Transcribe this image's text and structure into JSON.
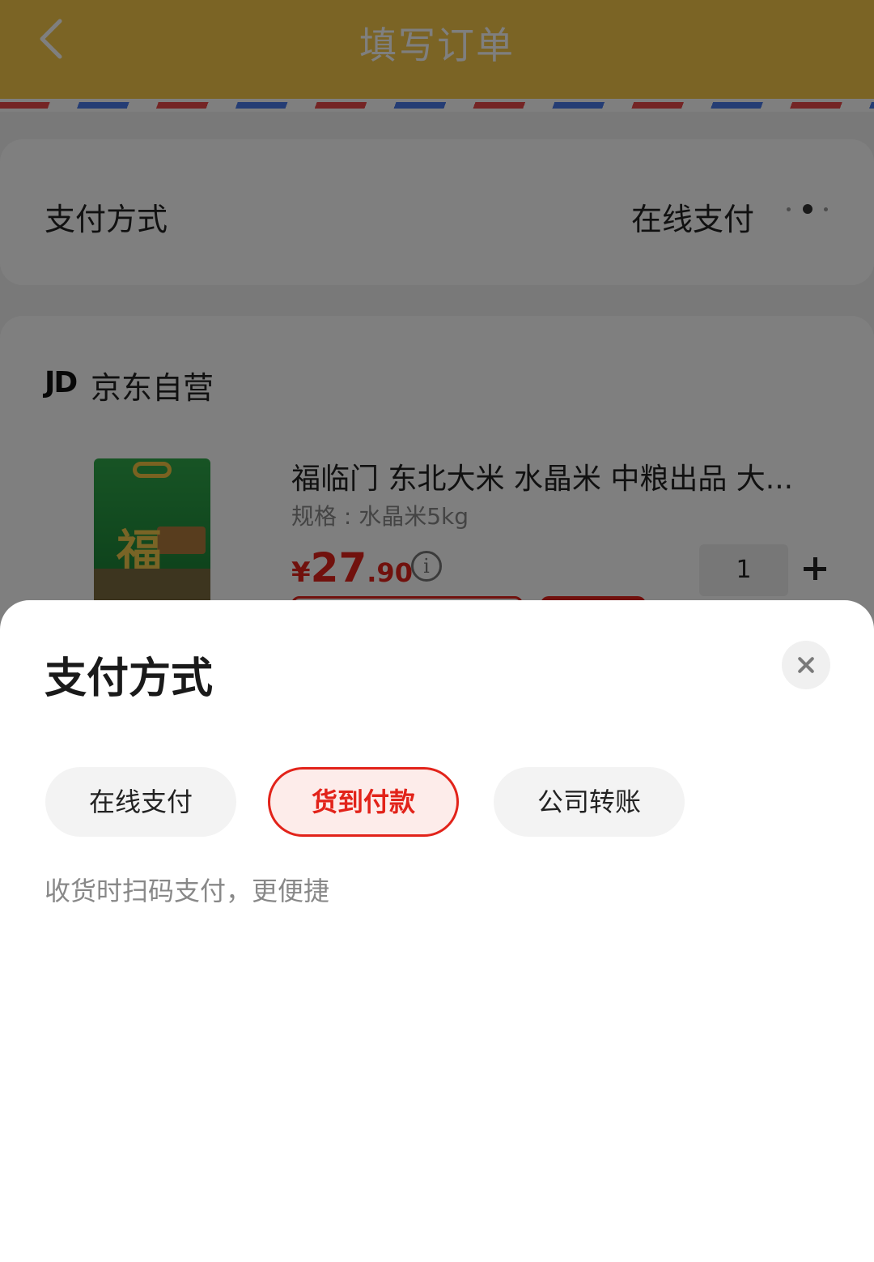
{
  "header": {
    "title": "填写订单"
  },
  "payment_row": {
    "label": "支付方式",
    "value": "在线支付"
  },
  "shop": {
    "logo": "JD",
    "name": "京东自营"
  },
  "product": {
    "title": "福临门 东北大米 水晶米 中粮出品 大...",
    "spec": "规格 : 水晶米5kg",
    "price_symbol": "¥",
    "price_int": "27",
    "price_dec": ".90",
    "quantity": "1",
    "image_text": "福"
  },
  "sheet": {
    "title": "支付方式",
    "options": [
      "在线支付",
      "货到付款",
      "公司转账"
    ],
    "selected": "货到付款",
    "hint": "收货时扫码支付，更便捷"
  },
  "colors": {
    "header_bg": "#f6c84b",
    "accent": "#e2231a",
    "selected_bg": "#fdecea"
  },
  "icons": [
    "back-arrow-icon",
    "more-dots-icon",
    "info-icon",
    "plus-icon",
    "close-icon"
  ]
}
